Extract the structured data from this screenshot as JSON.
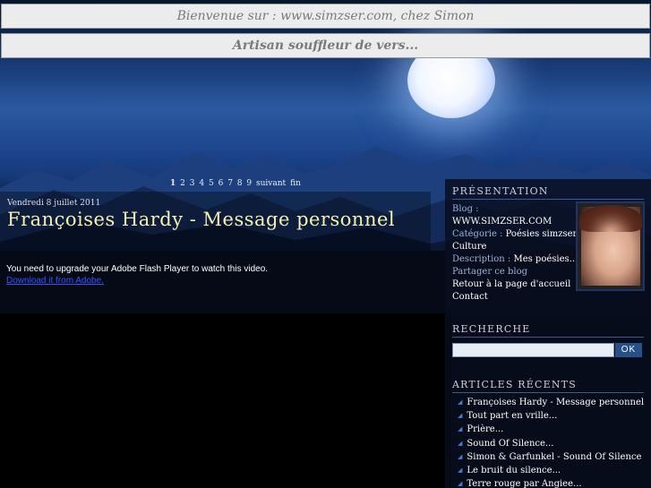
{
  "header": {
    "welcome": "Bienvenue sur : www.simzser.com, chez Simon",
    "tagline": "Artisan souffleur de vers..."
  },
  "pager": {
    "pages": [
      "1",
      "2",
      "3",
      "4",
      "5",
      "6",
      "7",
      "8",
      "9"
    ],
    "current": "1",
    "next": "suivant",
    "last": "fin"
  },
  "post": {
    "date": "Vendredi 8 juillet 2011",
    "title": "Françoises Hardy - Message personnel",
    "flash_message": "You need to upgrade your Adobe Flash Player to watch this video.",
    "flash_link": "Download it from Adobe."
  },
  "sidebar": {
    "presentation": {
      "title": "PRÉSENTATION",
      "blog_key": "Blog :",
      "blog_value": "WWW.SIMZSER.COM",
      "category_key": "Catégorie :",
      "category_value": "Poésies simzser",
      "category_value2": "Culture",
      "description_key": "Description :",
      "description_value": "Mes poésies...",
      "share": "Partager ce blog",
      "home": "Retour à la page d'accueil",
      "contact": "Contact"
    },
    "search": {
      "title": "RECHERCHE",
      "value": "",
      "button": "OK"
    },
    "recent": {
      "title": "ARTICLES RÉCENTS",
      "items": [
        "Françoises Hardy - Message personnel",
        "Tout part en vrille...",
        "Prière...",
        "Sound Of Silence...",
        "Simon & Garfunkel - Sound Of Silence",
        "Le bruit du silence...",
        "Terre rouge par Angiee..."
      ]
    }
  },
  "colors": {
    "title": "#f4f0b0",
    "accent": "#26508a",
    "link": "#3355ff"
  },
  "icons": {
    "bullet": "triangle-bullet-icon"
  }
}
